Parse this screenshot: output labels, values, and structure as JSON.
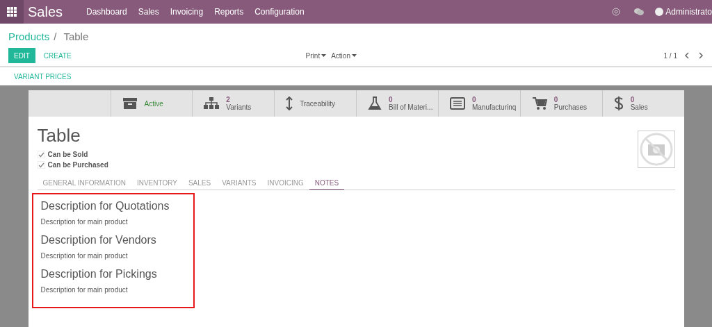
{
  "topbar": {
    "app": "Sales",
    "menu": [
      "Dashboard",
      "Sales",
      "Invoicing",
      "Reports",
      "Configuration"
    ],
    "user": "Administrato"
  },
  "breadcrumb": {
    "parent": "Products",
    "separator": "/",
    "current": "Table"
  },
  "buttons": {
    "edit": "EDIT",
    "create": "CREATE",
    "print": "Print",
    "action": "Action",
    "pager": "1 / 1"
  },
  "header_button": "VARIANT PRICES",
  "smart_buttons": [
    {
      "kind": "archive",
      "label": "Active"
    },
    {
      "kind": "variants",
      "count": "2",
      "label": "Variants"
    },
    {
      "kind": "traceability",
      "label": "Traceability"
    },
    {
      "kind": "bom",
      "count": "0",
      "label": "Bill of Materi..."
    },
    {
      "kind": "manufacturing",
      "count": "0",
      "label": "Manufacturinq"
    },
    {
      "kind": "purchases",
      "count": "0",
      "label": "Purchases"
    },
    {
      "kind": "sales",
      "count": "0",
      "label": "Sales"
    }
  ],
  "product": {
    "name": "Table",
    "options": [
      {
        "label": "Can be Sold",
        "checked": true
      },
      {
        "label": "Can be Purchased",
        "checked": true
      }
    ]
  },
  "tabs": [
    {
      "label": "GENERAL INFORMATION",
      "selected": false
    },
    {
      "label": "INVENTORY",
      "selected": false
    },
    {
      "label": "SALES",
      "selected": false
    },
    {
      "label": "VARIANTS",
      "selected": false
    },
    {
      "label": "INVOICING",
      "selected": false
    },
    {
      "label": "NOTES",
      "selected": true
    }
  ],
  "notes": [
    {
      "heading": "Description for Quotations",
      "text": "Description for main product"
    },
    {
      "heading": "Description for Vendors",
      "text": "Description for main product"
    },
    {
      "heading": "Description for Pickings",
      "text": "Description for main product"
    }
  ]
}
